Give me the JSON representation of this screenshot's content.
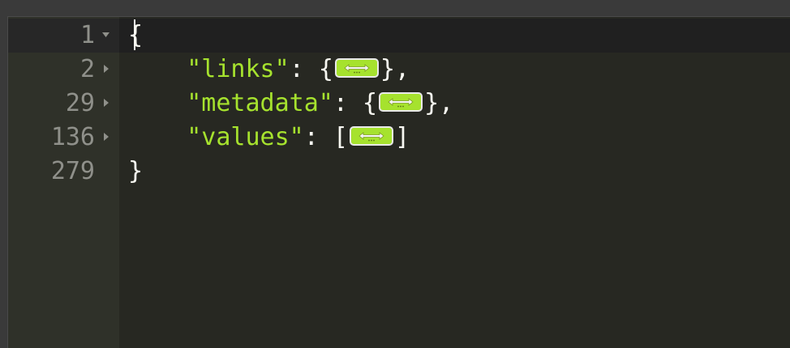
{
  "editor": {
    "lines": [
      {
        "number": "1",
        "fold": "open",
        "indent": "",
        "key": "",
        "sep": "",
        "open": "{",
        "widget": false,
        "close": "",
        "tail": ""
      },
      {
        "number": "2",
        "fold": "closed",
        "indent": "    ",
        "key": "\"links\"",
        "sep": ": ",
        "open": "{",
        "widget": true,
        "close": "}",
        "tail": ","
      },
      {
        "number": "29",
        "fold": "closed",
        "indent": "    ",
        "key": "\"metadata\"",
        "sep": ": ",
        "open": "{",
        "widget": true,
        "close": "}",
        "tail": ","
      },
      {
        "number": "136",
        "fold": "closed",
        "indent": "    ",
        "key": "\"values\"",
        "sep": ": ",
        "open": "[",
        "widget": true,
        "close": "]",
        "tail": ""
      },
      {
        "number": "279",
        "fold": "none",
        "indent": "",
        "key": "",
        "sep": "",
        "open": "}",
        "widget": false,
        "close": "",
        "tail": ""
      }
    ],
    "fold_widget_icon": "expand-arrows-icon",
    "colors": {
      "background": "#272822",
      "gutter": "#2f3129",
      "key": "#a6e22e",
      "text": "#f8f8f2",
      "line_number": "#8f908a",
      "fold_widget": "#a6e22e"
    }
  }
}
